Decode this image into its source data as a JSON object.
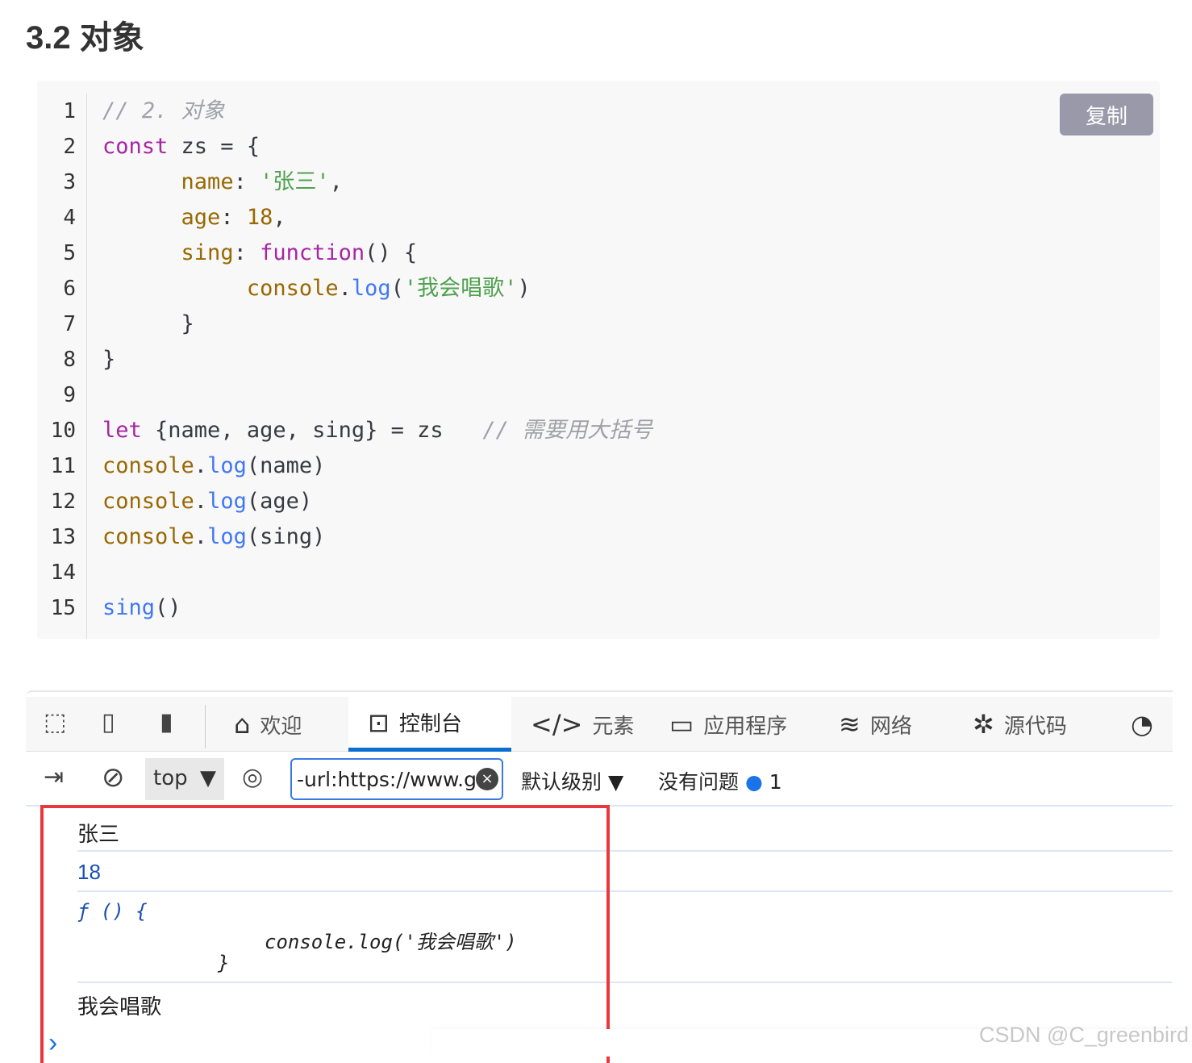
{
  "heading": "3.2 对象",
  "code": {
    "copy_label": "复制",
    "lines": [
      [
        [
          "com",
          "// 2. 对象"
        ]
      ],
      [
        [
          "kw",
          "const"
        ],
        [
          "plain",
          " zs = {"
        ]
      ],
      [
        [
          "plain",
          "      "
        ],
        [
          "prop",
          "name"
        ],
        [
          "plain",
          ": "
        ],
        [
          "str",
          "'张三'"
        ],
        [
          "plain",
          ","
        ]
      ],
      [
        [
          "plain",
          "      "
        ],
        [
          "prop",
          "age"
        ],
        [
          "plain",
          ": "
        ],
        [
          "prop",
          "18"
        ],
        [
          "plain",
          ","
        ]
      ],
      [
        [
          "plain",
          "      "
        ],
        [
          "prop",
          "sing"
        ],
        [
          "plain",
          ": "
        ],
        [
          "kw",
          "function"
        ],
        [
          "plain",
          "() {"
        ]
      ],
      [
        [
          "plain",
          "           "
        ],
        [
          "prop",
          "console"
        ],
        [
          "plain",
          "."
        ],
        [
          "fn",
          "log"
        ],
        [
          "plain",
          "("
        ],
        [
          "str",
          "'我会唱歌'"
        ],
        [
          "plain",
          ")"
        ]
      ],
      [
        [
          "plain",
          "      }"
        ]
      ],
      [
        [
          "plain",
          "}"
        ]
      ],
      [],
      [
        [
          "kw",
          "let"
        ],
        [
          "plain",
          " {name, age, sing} = zs   "
        ],
        [
          "com",
          "// 需要用大括号"
        ]
      ],
      [
        [
          "prop",
          "console"
        ],
        [
          "plain",
          "."
        ],
        [
          "fn",
          "log"
        ],
        [
          "plain",
          "(name)"
        ]
      ],
      [
        [
          "prop",
          "console"
        ],
        [
          "plain",
          "."
        ],
        [
          "fn",
          "log"
        ],
        [
          "plain",
          "(age)"
        ]
      ],
      [
        [
          "prop",
          "console"
        ],
        [
          "plain",
          "."
        ],
        [
          "fn",
          "log"
        ],
        [
          "plain",
          "(sing)"
        ]
      ],
      [],
      [
        [
          "fn",
          "sing"
        ],
        [
          "plain",
          "()"
        ]
      ]
    ]
  },
  "devtools": {
    "tabs": [
      {
        "label": "欢迎",
        "icon": "home-icon"
      },
      {
        "label": "控制台",
        "icon": "console-icon",
        "active": true
      },
      {
        "label": "元素",
        "icon": "code-icon"
      },
      {
        "label": "应用程序",
        "icon": "app-icon"
      },
      {
        "label": "网络",
        "icon": "wifi-icon"
      },
      {
        "label": "源代码",
        "icon": "bug-icon"
      }
    ],
    "context": "top",
    "filter_value": "-url:https://www.gc",
    "level": "默认级别",
    "issues": "没有问题",
    "issue_count": "1",
    "accent": "#0a6fd1"
  },
  "console": {
    "out1": "张三",
    "out2": "18",
    "fn_line1": "ƒ () {",
    "fn_line2": "console.log('我会唱歌')",
    "fn_line3": "}",
    "out4": "我会唱歌",
    "prompt": "›"
  },
  "watermark": "CSDN @C_greenbird"
}
